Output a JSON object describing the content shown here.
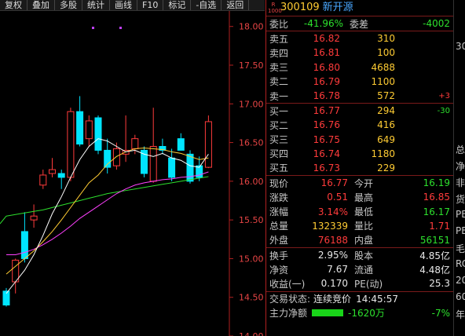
{
  "toolbar": [
    "复权",
    "叠加",
    "多股",
    "统计",
    "画线",
    "F10",
    "标记",
    "-自选",
    "返回"
  ],
  "chart": {
    "price_ticks": [
      "18.00",
      "17.50",
      "17.00",
      "16.50",
      "16.00",
      "15.50",
      "15.00",
      "14.50",
      "14.00"
    ],
    "colors": {
      "up": "#ff3b3b",
      "down": "#00e5ff",
      "ma5": "#ffffff",
      "ma10": "#ffcc33",
      "ma20": "#ff40ff",
      "ma60": "#2de02d"
    }
  },
  "chart_data": {
    "type": "candlestick",
    "ylim": [
      14.0,
      18.2
    ],
    "candles": [
      {
        "o": 14.58,
        "h": 14.62,
        "l": 14.38,
        "c": 14.4
      },
      {
        "o": 14.7,
        "h": 15.0,
        "l": 14.55,
        "c": 14.98
      },
      {
        "o": 15.35,
        "h": 15.6,
        "l": 14.95,
        "c": 15.0
      },
      {
        "o": 15.5,
        "h": 15.7,
        "l": 15.4,
        "c": 15.55
      },
      {
        "o": 15.95,
        "h": 16.15,
        "l": 15.9,
        "c": 16.08
      },
      {
        "o": 16.1,
        "h": 16.3,
        "l": 16.05,
        "c": 16.15
      },
      {
        "o": 16.1,
        "h": 16.15,
        "l": 15.9,
        "c": 16.05
      },
      {
        "o": 16.05,
        "h": 16.95,
        "l": 16.0,
        "c": 16.9
      },
      {
        "o": 16.9,
        "h": 17.1,
        "l": 16.45,
        "c": 16.48
      },
      {
        "o": 16.55,
        "h": 16.85,
        "l": 16.45,
        "c": 16.78
      },
      {
        "o": 16.82,
        "h": 16.85,
        "l": 16.35,
        "c": 16.4
      },
      {
        "o": 16.4,
        "h": 16.55,
        "l": 16.1,
        "c": 16.18
      },
      {
        "o": 16.2,
        "h": 16.5,
        "l": 16.15,
        "c": 16.42
      },
      {
        "o": 16.35,
        "h": 16.85,
        "l": 16.25,
        "c": 16.4
      },
      {
        "o": 16.42,
        "h": 16.6,
        "l": 16.35,
        "c": 16.55
      },
      {
        "o": 16.4,
        "h": 16.45,
        "l": 16.05,
        "c": 16.1
      },
      {
        "o": 16.0,
        "h": 16.95,
        "l": 15.98,
        "c": 16.45
      },
      {
        "o": 16.45,
        "h": 16.55,
        "l": 16.35,
        "c": 16.4
      },
      {
        "o": 16.3,
        "h": 16.42,
        "l": 16.0,
        "c": 16.05
      },
      {
        "o": 16.55,
        "h": 16.62,
        "l": 16.45,
        "c": 16.4
      },
      {
        "o": 16.35,
        "h": 16.4,
        "l": 15.97,
        "c": 16.0
      },
      {
        "o": 16.2,
        "h": 16.32,
        "l": 16.0,
        "c": 16.05
      },
      {
        "o": 16.18,
        "h": 16.85,
        "l": 16.17,
        "c": 16.77
      }
    ],
    "ma5": [
      14.55,
      14.7,
      14.85,
      15.05,
      15.3,
      15.58,
      15.8,
      16.05,
      16.28,
      16.45,
      16.55,
      16.52,
      16.45,
      16.38,
      16.4,
      16.35,
      16.32,
      16.36,
      16.3,
      16.27,
      16.2,
      16.18,
      16.35
    ],
    "ma10": [
      14.8,
      14.9,
      15.0,
      15.1,
      15.22,
      15.35,
      15.5,
      15.66,
      15.82,
      15.98,
      16.08,
      16.22,
      16.32,
      16.38,
      16.42,
      16.43,
      16.42,
      16.41,
      16.38,
      16.36,
      16.32,
      16.28,
      16.3
    ],
    "ma20": [
      15.05,
      15.05,
      15.08,
      15.12,
      15.18,
      15.25,
      15.33,
      15.42,
      15.52,
      15.6,
      15.68,
      15.76,
      15.84,
      15.9,
      15.95,
      15.98,
      16.0,
      16.02,
      16.03,
      16.05,
      16.06,
      16.08,
      16.12
    ],
    "ma60": [
      15.55,
      15.57,
      15.59,
      15.61,
      15.63,
      15.66,
      15.69,
      15.72,
      15.75,
      15.78,
      15.81,
      15.84,
      15.86,
      15.88,
      15.9,
      15.92,
      15.94,
      15.96,
      15.98,
      16.0,
      16.02,
      16.04,
      16.06
    ]
  },
  "header": {
    "r_flag": "R",
    "r_sub": "1000",
    "code": "300109",
    "name": "新开源"
  },
  "weibi": {
    "l1": "委比",
    "v1": "-41.96%",
    "l2": "委差",
    "v2": "-4002"
  },
  "asks": [
    {
      "label": "卖五",
      "price": "16.82",
      "vol": "310",
      "chg": ""
    },
    {
      "label": "卖四",
      "price": "16.81",
      "vol": "100",
      "chg": ""
    },
    {
      "label": "卖三",
      "price": "16.80",
      "vol": "4688",
      "chg": ""
    },
    {
      "label": "卖二",
      "price": "16.79",
      "vol": "1100",
      "chg": ""
    },
    {
      "label": "卖一",
      "price": "16.78",
      "vol": "572",
      "chg": "+3"
    }
  ],
  "bids": [
    {
      "label": "买一",
      "price": "16.77",
      "vol": "294",
      "chg": "-30"
    },
    {
      "label": "买二",
      "price": "16.76",
      "vol": "416",
      "chg": ""
    },
    {
      "label": "买三",
      "price": "16.75",
      "vol": "649",
      "chg": ""
    },
    {
      "label": "买四",
      "price": "16.74",
      "vol": "1180",
      "chg": ""
    },
    {
      "label": "买五",
      "price": "16.73",
      "vol": "229",
      "chg": ""
    }
  ],
  "quote": [
    [
      {
        "l": "现价",
        "v": "16.77",
        "c": "red"
      },
      {
        "l": "今开",
        "v": "16.19",
        "c": "green"
      }
    ],
    [
      {
        "l": "涨跌",
        "v": "0.51",
        "c": "red"
      },
      {
        "l": "最高",
        "v": "16.85",
        "c": "red"
      }
    ],
    [
      {
        "l": "涨幅",
        "v": "3.14%",
        "c": "red"
      },
      {
        "l": "最低",
        "v": "16.17",
        "c": "green"
      }
    ],
    [
      {
        "l": "总量",
        "v": "132339",
        "c": "yel"
      },
      {
        "l": "量比",
        "v": "1.71",
        "c": "red"
      }
    ],
    [
      {
        "l": "外盘",
        "v": "76188",
        "c": "red"
      },
      {
        "l": "内盘",
        "v": "56151",
        "c": "green"
      }
    ]
  ],
  "fund": [
    [
      {
        "l": "换手",
        "v": "2.95%"
      },
      {
        "l": "股本",
        "v": "4.85亿"
      }
    ],
    [
      {
        "l": "净资",
        "v": "7.67"
      },
      {
        "l": "流通",
        "v": "4.48亿"
      }
    ],
    [
      {
        "l": "收益(一)",
        "v": "0.170"
      },
      {
        "l": "PE(动)",
        "v": "25.3"
      }
    ]
  ],
  "status": {
    "label": "交易状态:",
    "value": "连续竞价",
    "time": "14:45:57"
  },
  "flow": {
    "label": "主力净额",
    "value": "-1620万",
    "pct": "-7%"
  },
  "edge": {
    "top": "30",
    "items": [
      "总",
      "净",
      "非",
      "货",
      "PE",
      "PE",
      "毛",
      "RC",
      "20",
      "60",
      "年"
    ]
  }
}
